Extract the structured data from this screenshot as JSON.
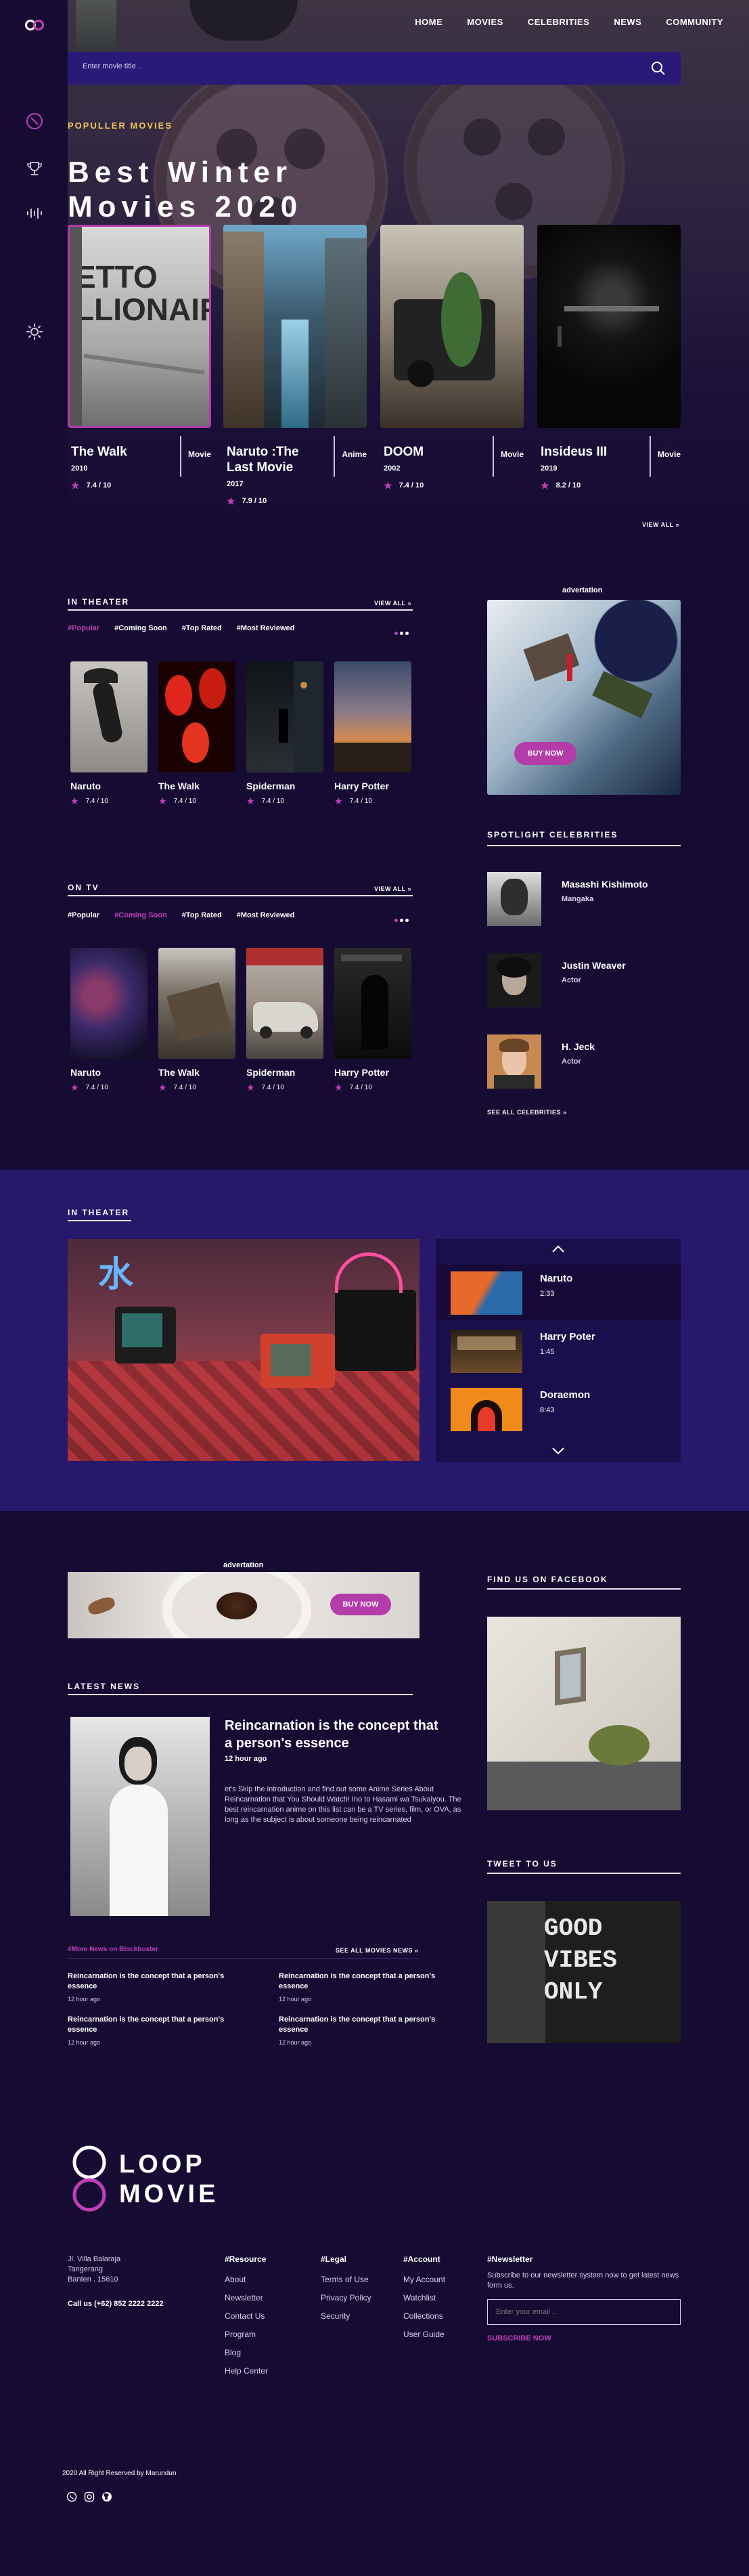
{
  "nav": [
    "HOME",
    "MOVIES",
    "CELEBRITIES",
    "NEWS",
    "COMMUNITY"
  ],
  "search": {
    "placeholder": "Enter movie title .."
  },
  "hero": {
    "eyebrow": "POPULLER MOVIES",
    "title_line1": "Best Winter",
    "title_line2": "Movies 2020",
    "view_all": "VIEW ALL »",
    "cards": [
      {
        "title": "The Walk",
        "year": "2010",
        "genre": "Movie",
        "rating": "7.4 / 10"
      },
      {
        "title": "Naruto :The Last Movie",
        "year": "2017",
        "genre": "Anime",
        "rating": "7.9 / 10"
      },
      {
        "title": "DOOM",
        "year": "2002",
        "genre": "Movie",
        "rating": "7.4 / 10"
      },
      {
        "title": "Insideus III",
        "year": "2019",
        "genre": "Movie",
        "rating": "8.2 / 10"
      }
    ]
  },
  "in_theater": {
    "title": "IN THEATER",
    "view_all": "VIEW ALL »",
    "tabs": [
      "#Popular",
      "#Coming Soon",
      "#Top Rated",
      "#Most Reviewed"
    ],
    "movies": [
      {
        "title": "Naruto",
        "rating": "7.4 / 10"
      },
      {
        "title": "The Walk",
        "rating": "7.4 / 10"
      },
      {
        "title": "Spiderman",
        "rating": "7.4 / 10"
      },
      {
        "title": "Harry Potter",
        "rating": "7.4 / 10"
      }
    ]
  },
  "on_tv": {
    "title": "ON TV",
    "view_all": "VIEW ALL »",
    "tabs": [
      "#Popular",
      "#Coming Soon",
      "#Top Rated",
      "#Most Reviewed"
    ],
    "movies": [
      {
        "title": "Naruto",
        "rating": "7.4 / 10"
      },
      {
        "title": "The Walk",
        "rating": "7.4 / 10"
      },
      {
        "title": "Spiderman",
        "rating": "7.4 / 10"
      },
      {
        "title": "Harry Potter",
        "rating": "7.4 / 10"
      }
    ]
  },
  "ad1": {
    "label": "advertation",
    "button": "BUY NOW"
  },
  "celebrities": {
    "title": "SPOTLIGHT CELEBRITIES",
    "see_all": "SEE ALL CELEBRITIES »",
    "people": [
      {
        "name": "Masashi Kishimoto",
        "role": "Mangaka"
      },
      {
        "name": "Justin Weaver",
        "role": "Actor"
      },
      {
        "name": "H. Jeck",
        "role": "Actor"
      }
    ]
  },
  "theater2": {
    "title": "IN THEATER",
    "playlist": [
      {
        "name": "Naruto",
        "duration": "2:33"
      },
      {
        "name": "Harry Poter",
        "duration": "1:45"
      },
      {
        "name": "Doraemon",
        "duration": "8:43"
      }
    ]
  },
  "ad2": {
    "label": "advertation",
    "button": "BUY NOW"
  },
  "latest_news": {
    "title": "LATEST NEWS",
    "headline": "Reincarnation is the concept that a person's essence",
    "time": "12 hour ago",
    "body": "et's Skip the introduction and find out some Anime Series About Reincarnation that You Should Watch! Ino to Hasami wa Tsukaiyou. The best reincarnation anime on this list can be a TV series, film, or OVA, as long as the subject is about someone being reincarnated",
    "more_label": "#More News on Blockbuster",
    "see_all": "SEE ALL MOVIES NEWS »",
    "items": [
      {
        "title": "Reincarnation is the concept that a person's essence",
        "time": "12 hour ago"
      },
      {
        "title": "Reincarnation is the concept that a person's essence",
        "time": "12 hour ago"
      },
      {
        "title": "Reincarnation is the concept that a person's essence",
        "time": "12 hour ago"
      },
      {
        "title": "Reincarnation is the concept that a person's essence",
        "time": "12 hour ago"
      }
    ]
  },
  "facebook": {
    "title": "FIND US ON FACEBOOK"
  },
  "twitter": {
    "title": "TWEET TO US",
    "sign_text": [
      "GOOD",
      "VIBES",
      "ONLY"
    ]
  },
  "footer": {
    "brand_line1": "LOOP",
    "brand_line2": "MOVIE",
    "address": [
      "Jl. Villa Balaraja",
      "Tangerang",
      "Banten . 15610"
    ],
    "phone": "Call us (+62) 852 2222 2222",
    "resource": {
      "title": "#Resource",
      "links": [
        "About",
        "Newsletter",
        "Contact Us",
        "Program",
        "Blog",
        "Help Center"
      ]
    },
    "legal": {
      "title": "#Legal",
      "links": [
        "Terms of Use",
        "Privacy Policy",
        "Security"
      ]
    },
    "account": {
      "title": "#Account",
      "links": [
        "My Account",
        "Watchlist",
        "Collections",
        "User Guide"
      ]
    },
    "newsletter": {
      "title": "#Newsletter",
      "text": "Subscribe to our newsletter system now to get latest news form us.",
      "placeholder": "Enter your email ..",
      "button": "SUBSCRIBE NOW"
    },
    "copyright": "2020 All Right Reserved by Marundun"
  },
  "colors": {
    "background": "#160c33",
    "accent": "#c23fb8",
    "band": "#27186b",
    "search": "#2a1a78"
  }
}
